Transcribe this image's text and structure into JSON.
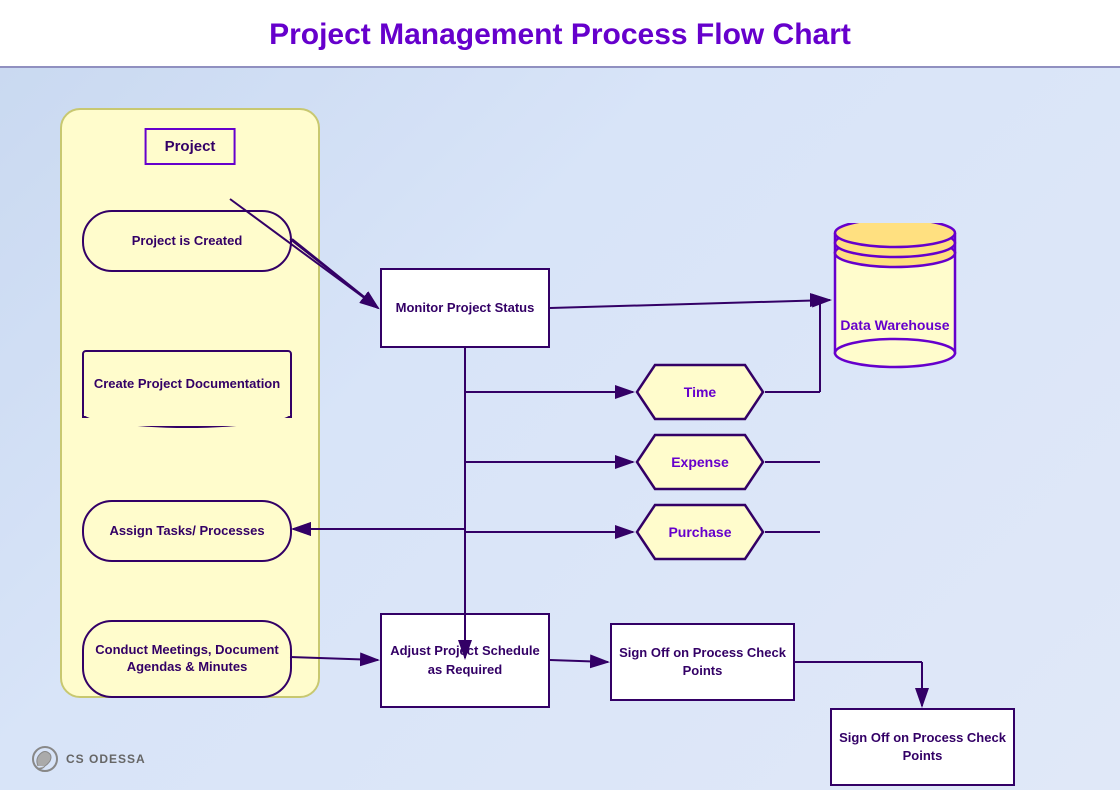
{
  "title": "Project Management Process Flow Chart",
  "swimlane": {
    "label": "Project"
  },
  "nodes": {
    "project_created": "Project is Created",
    "monitor_status": "Monitor Project Status",
    "create_docs": "Create Project Documentation",
    "assign_tasks": "Assign Tasks/ Processes",
    "conduct_meetings": "Conduct Meetings, Document Agendas & Minutes",
    "time": "Time",
    "expense": "Expense",
    "purchase": "Purchase",
    "data_warehouse": "Data Warehouse",
    "adjust_schedule": "Adjust Project Schedule as Required",
    "sign_off_1": "Sign Off on Process Check Points",
    "sign_off_2": "Sign Off on Process Check Points"
  },
  "logo": "CS ODESSA"
}
